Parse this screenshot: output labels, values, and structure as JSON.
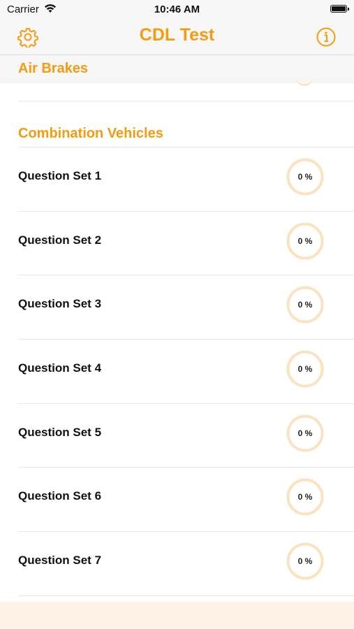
{
  "status_bar": {
    "carrier": "Carrier",
    "time": "10:46 AM"
  },
  "nav": {
    "title": "CDL Test",
    "left_icon": "gear-icon",
    "right_icon": "info-icon"
  },
  "sticky_section": {
    "title": "Air Brakes"
  },
  "section": {
    "title": "Combination Vehicles",
    "items": [
      {
        "label": "Question Set 1",
        "progress": "0 %",
        "progress_value": 0
      },
      {
        "label": "Question Set 2",
        "progress": "0 %",
        "progress_value": 0
      },
      {
        "label": "Question Set 3",
        "progress": "0 %",
        "progress_value": 0
      },
      {
        "label": "Question Set 4",
        "progress": "0 %",
        "progress_value": 0
      },
      {
        "label": "Question Set 5",
        "progress": "0 %",
        "progress_value": 0
      },
      {
        "label": "Question Set 6",
        "progress": "0 %",
        "progress_value": 0
      },
      {
        "label": "Question Set 7",
        "progress": "0 %",
        "progress_value": 0
      }
    ]
  },
  "colors": {
    "accent": "#f39c12",
    "ring_track": "#fbe3c0",
    "bottom_bar": "#fef2e6"
  }
}
